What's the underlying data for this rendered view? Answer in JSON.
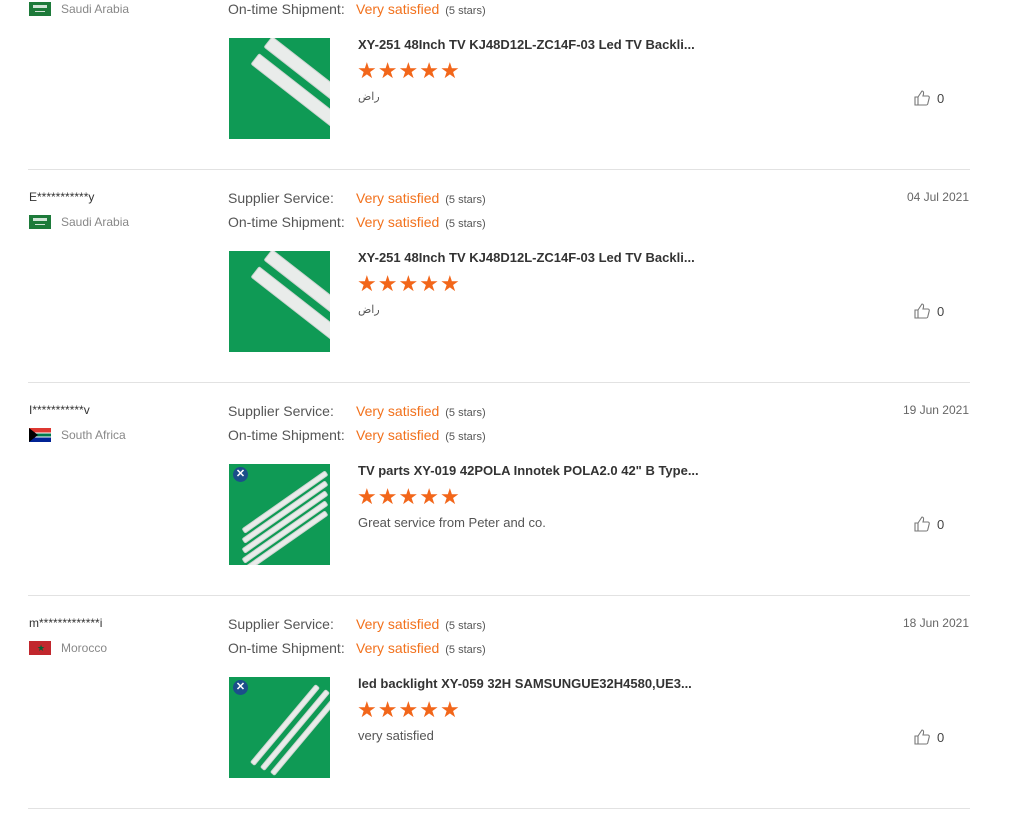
{
  "labels": {
    "supplier_service": "Supplier Service:",
    "ontime_shipment": "On-time Shipment:"
  },
  "reviews": [
    {
      "user": "",
      "country": "Saudi Arabia",
      "date": "",
      "ontime_rating": "Very satisfied",
      "ontime_stars": "(5 stars)",
      "product_title": "XY-251 48Inch TV KJ48D12L-ZC14F-03 Led TV Backli...",
      "stars": 5,
      "comment": "راض",
      "likes": "0"
    },
    {
      "user": "E***********y",
      "country": "Saudi Arabia",
      "date": "04 Jul 2021",
      "supplier_rating": "Very satisfied",
      "supplier_stars": "(5 stars)",
      "ontime_rating": "Very satisfied",
      "ontime_stars": "(5 stars)",
      "product_title": "XY-251 48Inch TV KJ48D12L-ZC14F-03 Led TV Backli...",
      "stars": 5,
      "comment": "راض",
      "likes": "0"
    },
    {
      "user": "I***********v",
      "country": "South Africa",
      "date": "19 Jun 2021",
      "supplier_rating": "Very satisfied",
      "supplier_stars": "(5 stars)",
      "ontime_rating": "Very satisfied",
      "ontime_stars": "(5 stars)",
      "product_title": "TV parts XY-019 42POLA Innotek POLA2.0 42\" B Type...",
      "stars": 5,
      "comment": "Great service from Peter and co.",
      "likes": "0"
    },
    {
      "user": "m*************i",
      "country": "Morocco",
      "date": "18 Jun 2021",
      "supplier_rating": "Very satisfied",
      "supplier_stars": "(5 stars)",
      "ontime_rating": "Very satisfied",
      "ontime_stars": "(5 stars)",
      "product_title": "led backlight XY-059 32H SAMSUNGUE32H4580,UE3...",
      "stars": 5,
      "comment": "very satisfied",
      "likes": "0"
    }
  ],
  "colors": {
    "accent": "#f2711c",
    "star": "#f2661a",
    "thumb_bg": "#0f9a55"
  }
}
